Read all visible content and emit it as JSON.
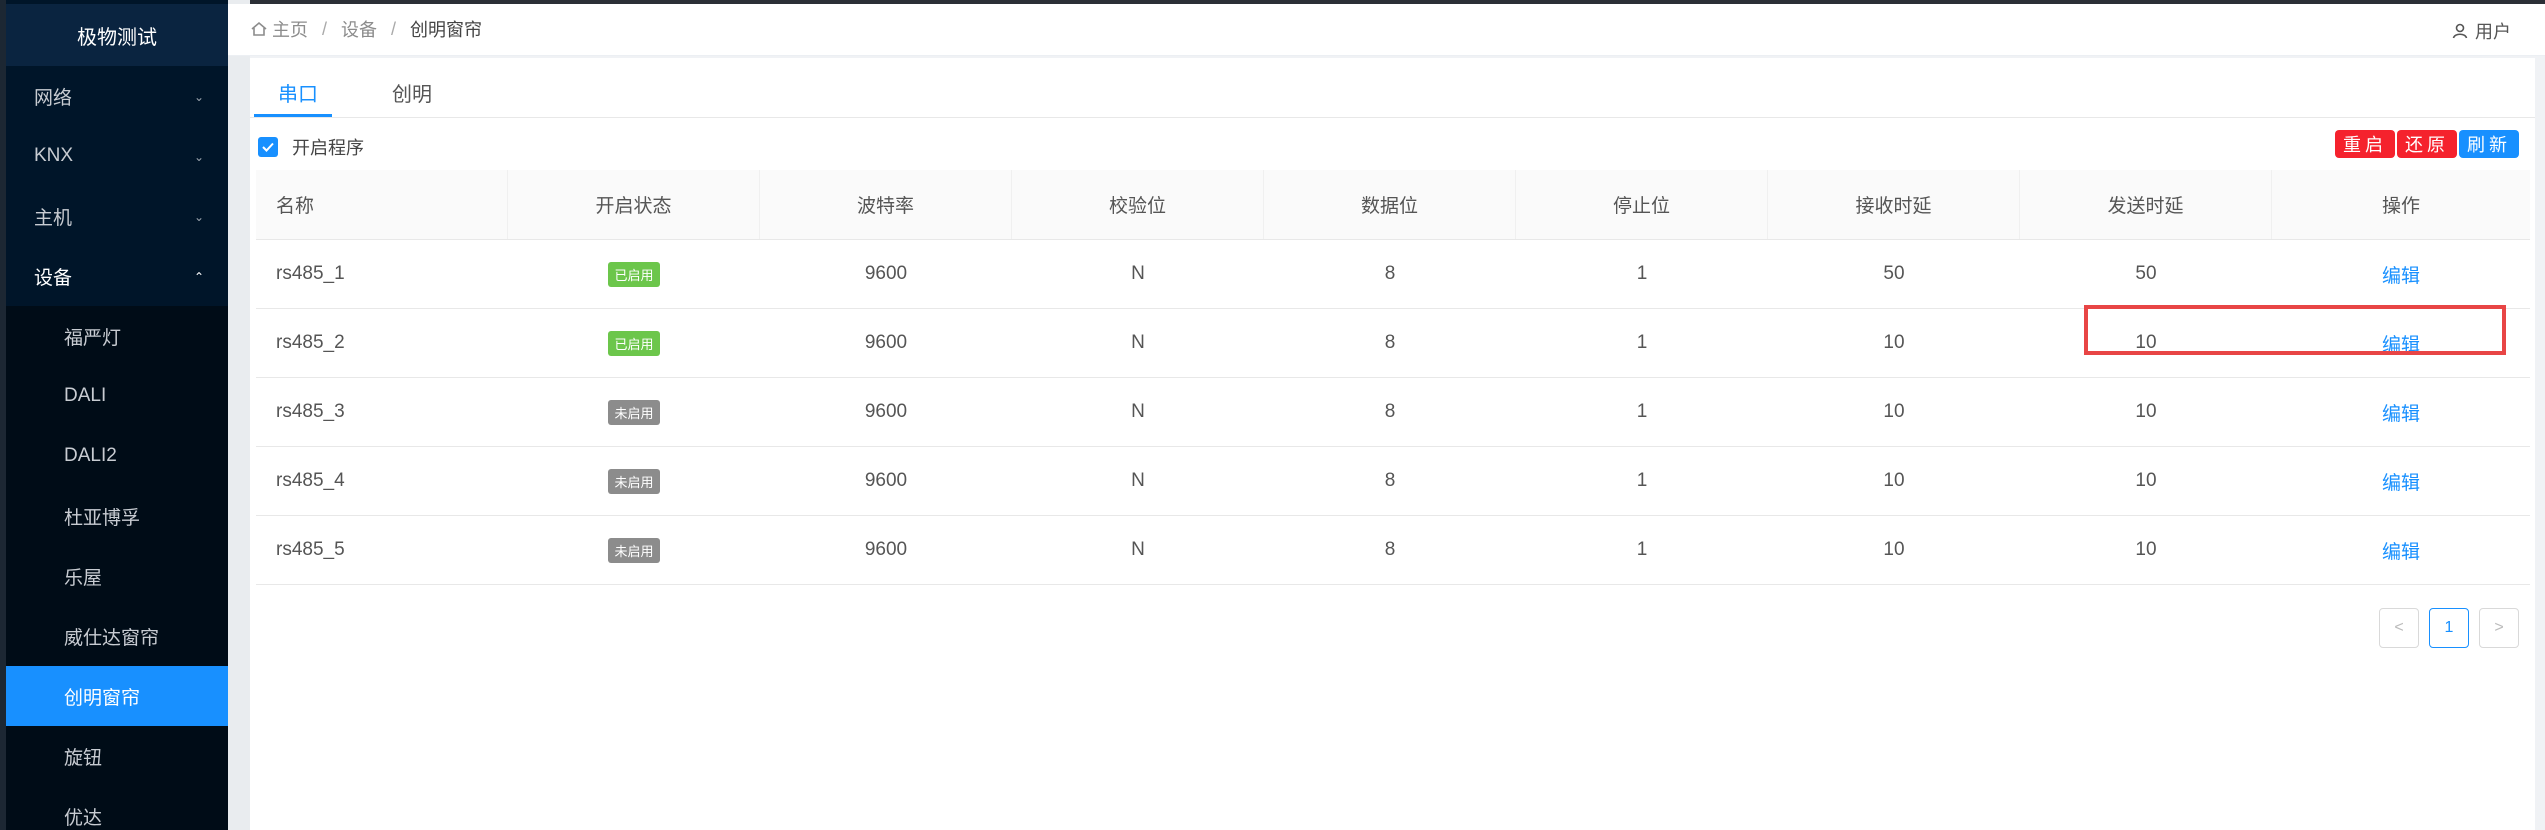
{
  "sidebar": {
    "brand": "极物测试",
    "menu": [
      {
        "label": "网络",
        "chevron": "chevron-down"
      },
      {
        "label": "KNX",
        "chevron": "chevron-down"
      },
      {
        "label": "主机",
        "chevron": "chevron-down"
      },
      {
        "label": "设备",
        "chevron": "chevron-up"
      }
    ],
    "submenu": [
      "福严灯",
      "DALI",
      "DALI2",
      "杜亚博孚",
      "乐屋",
      "威仕达窗帘",
      "创明窗帘",
      "旋钮",
      "优达"
    ],
    "active_submenu": "创明窗帘"
  },
  "header": {
    "breadcrumb": [
      "主页",
      "设备",
      "创明窗帘"
    ],
    "user": "用户"
  },
  "tabs": [
    "串口",
    "创明"
  ],
  "active_tab": "串口",
  "enable_program": {
    "label": "开启程序",
    "checked": true
  },
  "actions": {
    "restart": "重启",
    "restore": "还原",
    "refresh": "刷新"
  },
  "table": {
    "headers": [
      "名称",
      "开启状态",
      "波特率",
      "校验位",
      "数据位",
      "停止位",
      "接收时延",
      "发送时延",
      "操作"
    ],
    "rows": [
      {
        "name": "rs485_1",
        "status": "已启用",
        "enabled": true,
        "baud": "9600",
        "parity": "N",
        "databits": "8",
        "stopbits": "1",
        "rx": "50",
        "tx": "50",
        "op": "编辑"
      },
      {
        "name": "rs485_2",
        "status": "已启用",
        "enabled": true,
        "baud": "9600",
        "parity": "N",
        "databits": "8",
        "stopbits": "1",
        "rx": "10",
        "tx": "10",
        "op": "编辑"
      },
      {
        "name": "rs485_3",
        "status": "未启用",
        "enabled": false,
        "baud": "9600",
        "parity": "N",
        "databits": "8",
        "stopbits": "1",
        "rx": "10",
        "tx": "10",
        "op": "编辑"
      },
      {
        "name": "rs485_4",
        "status": "未启用",
        "enabled": false,
        "baud": "9600",
        "parity": "N",
        "databits": "8",
        "stopbits": "1",
        "rx": "10",
        "tx": "10",
        "op": "编辑"
      },
      {
        "name": "rs485_5",
        "status": "未启用",
        "enabled": false,
        "baud": "9600",
        "parity": "N",
        "databits": "8",
        "stopbits": "1",
        "rx": "10",
        "tx": "10",
        "op": "编辑"
      }
    ]
  },
  "pagination": {
    "prev": "<",
    "current": "1",
    "next": ">"
  },
  "colors": {
    "accent": "#1890ff",
    "danger": "#f5222d",
    "enabled": "#6cc64b",
    "disabled": "#8c8c8c",
    "sidebar": "#001529",
    "highlight_box": "#e84545"
  }
}
